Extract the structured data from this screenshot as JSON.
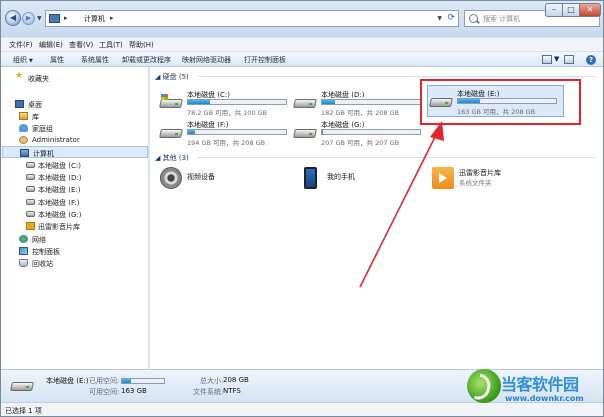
{
  "address": {
    "path": "计算机",
    "separator": "▸"
  },
  "search": {
    "placeholder": "搜索 计算机"
  },
  "menu": [
    "文件(F)",
    "编辑(E)",
    "查看(V)",
    "工具(T)",
    "帮助(H)"
  ],
  "toolbar": [
    "组织",
    "属性",
    "系统属性",
    "卸载或更改程序",
    "映射网络驱动器",
    "打开控制面板"
  ],
  "nav": {
    "favorites": "收藏夹",
    "desktop": "桌面",
    "library": "库",
    "homegroup": "家庭组",
    "user": "Administrator",
    "computer": "计算机",
    "drives": [
      "本地磁盘 (C:)",
      "本地磁盘 (D:)",
      "本地磁盘 (E:)",
      "本地磁盘 (F:)",
      "本地磁盘 (G:)"
    ],
    "xunlei": "迅雷影音片库",
    "network": "网络",
    "control_panel": "控制面板",
    "recycle": "回收站"
  },
  "groups": {
    "hdd": "硬盘 (5)",
    "other": "其他 (3)"
  },
  "drives": [
    {
      "name": "本地磁盘 (C:)",
      "free": "78.2 GB 可用，共 100 GB",
      "used_fraction": 0.22,
      "system": true
    },
    {
      "name": "本地磁盘 (D:)",
      "free": "182 GB 可用，共 208 GB",
      "used_fraction": 0.13,
      "system": false
    },
    {
      "name": "本地磁盘 (E:)",
      "free": "163 GB 可用，共 208 GB",
      "used_fraction": 0.22,
      "system": false
    },
    {
      "name": "本地磁盘 (F:)",
      "free": "194 GB 可用，共 208 GB",
      "used_fraction": 0.07,
      "system": false
    },
    {
      "name": "本地磁盘 (G:)",
      "free": "207 GB 可用，共 207 GB",
      "used_fraction": 0.01,
      "system": false
    }
  ],
  "other": [
    {
      "name": "视频设备",
      "sub": "",
      "icon": "camera-icon"
    },
    {
      "name": "我的手机",
      "sub": "",
      "icon": "phone-icon"
    },
    {
      "name": "迅雷影音片库",
      "sub": "系统文件夹",
      "icon": "xunlei-folder-icon"
    }
  ],
  "details": {
    "name": "本地磁盘 (E:)",
    "used_label": "已用空间:",
    "free_label": "可用空间:",
    "free_value": "163 GB",
    "total_label": "总大小:",
    "total_value": "208 GB",
    "fs_label": "文件系统:",
    "fs_value": "NTFS",
    "used_fraction": 0.22
  },
  "status": "已选择 1 项",
  "watermark": {
    "title": "当客软件园",
    "url": "www.downkr.com"
  },
  "colors": {
    "highlight": "#e4262c",
    "bar_fill": "#1f86c9"
  }
}
